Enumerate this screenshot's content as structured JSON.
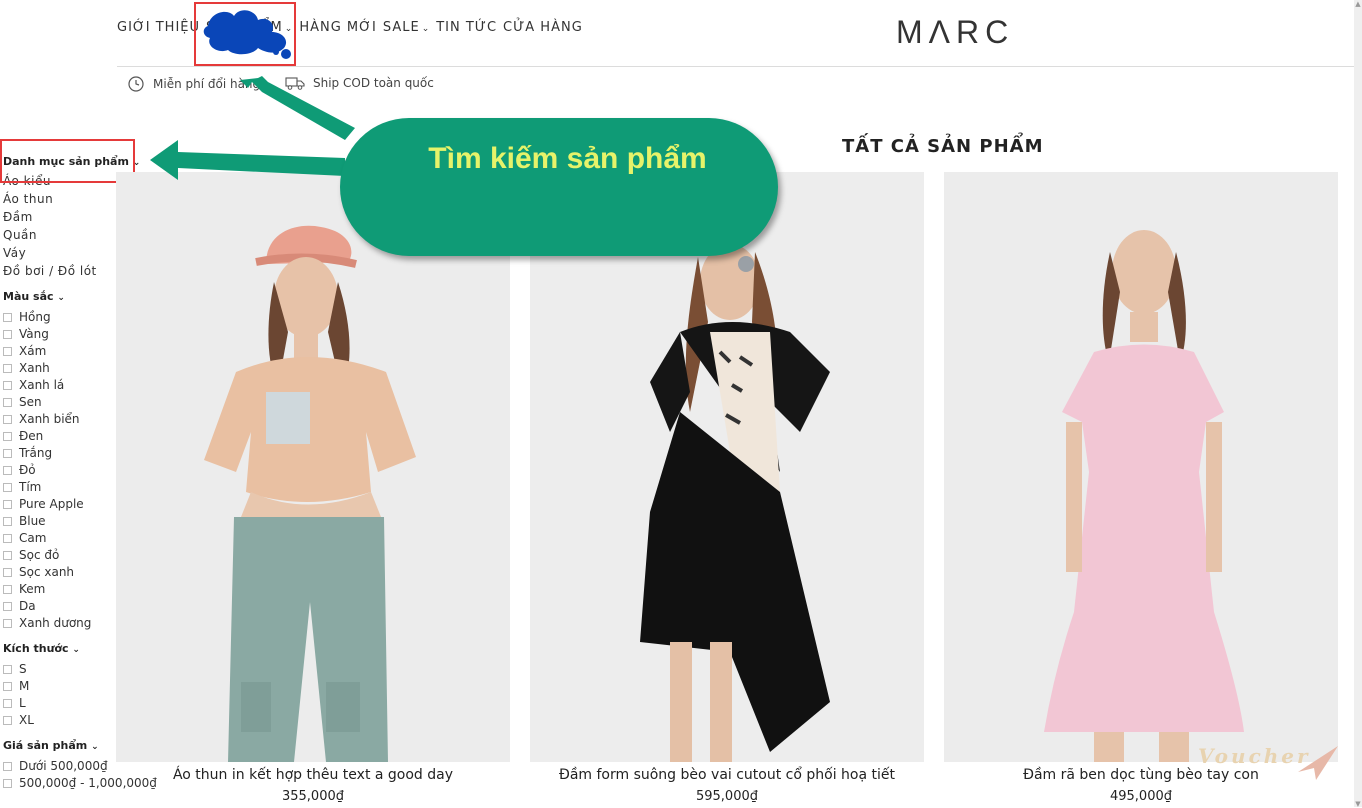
{
  "header": {
    "nav": [
      {
        "label": "GIỚI THIỆU",
        "chevron": false
      },
      {
        "label": "SẢN PHẨM",
        "chevron": true
      },
      {
        "label": "HÀNG MỚI",
        "chevron": false
      },
      {
        "label": "SALE",
        "chevron": true
      },
      {
        "label": "TIN TỨC",
        "chevron": false
      },
      {
        "label": "CỬA HÀNG",
        "chevron": false
      }
    ],
    "logo": "MΛRC",
    "perks": [
      "Miễn phí đổi hàng",
      "Ship COD toàn quốc"
    ]
  },
  "sidebar": {
    "category_heading": "Danh mục sản phẩm",
    "categories": [
      "Áo kiểu",
      "Áo thun",
      "Đầm",
      "Quần",
      "Váy",
      "Đồ bơi / Đồ lót"
    ],
    "color_heading": "Màu sắc",
    "colors": [
      "Hồng",
      "Vàng",
      "Xám",
      "Xanh",
      "Xanh lá",
      "Sen",
      "Xanh biển",
      "Đen",
      "Trắng",
      "Đỏ",
      "Tím",
      "Pure Apple",
      "Blue",
      "Cam",
      "Sọc đỏ",
      "Sọc xanh",
      "Kem",
      "Da",
      "Xanh dương"
    ],
    "size_heading": "Kích thước",
    "sizes": [
      "S",
      "M",
      "L",
      "XL"
    ],
    "price_heading": "Giá sản phẩm",
    "prices": [
      "Dưới 500,000₫",
      "500,000₫ - 1,000,000₫"
    ]
  },
  "main": {
    "title": "TẤT CẢ SẢN PHẨM",
    "products": [
      {
        "name": "Áo thun in kết hợp thêu text a good day",
        "price": "355,000₫"
      },
      {
        "name": "Đầm form suông bèo vai cutout cổ phối hoạ tiết",
        "price": "595,000₫"
      },
      {
        "name": "Đầm rã ben dọc tùng bèo tay con",
        "price": "495,000₫"
      }
    ]
  },
  "annotation": {
    "callout": "Tìm kiếm sản phẩm",
    "color": "#0f9b76",
    "text_color": "#e6f36a",
    "highlight_color": "#e53a3a"
  },
  "watermark": "Voucher"
}
